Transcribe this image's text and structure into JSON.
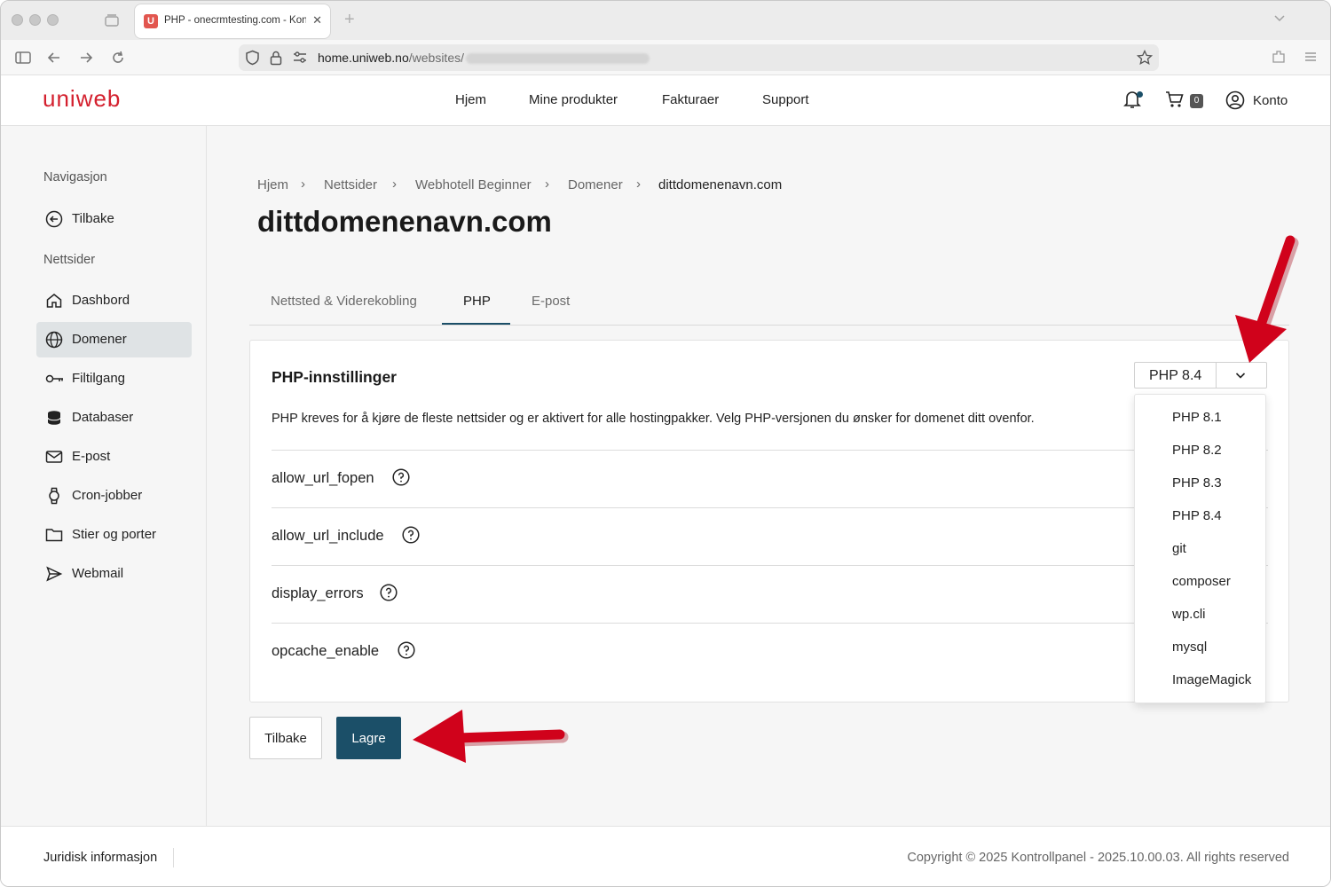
{
  "browser": {
    "tab_title": "PHP - onecrmtesting.com - Kontrollpanel",
    "tab_favicon_letter": "U",
    "url_domain": "home.uniweb.no",
    "url_path": "/websites/"
  },
  "header": {
    "logo": "uniweb",
    "nav": [
      "Hjem",
      "Mine produkter",
      "Fakturaer",
      "Support"
    ],
    "cart_count": "0",
    "account_label": "Konto"
  },
  "sidebar": {
    "heading_nav": "Navigasjon",
    "back_label": "Tilbake",
    "heading_sites": "Nettsider",
    "items": [
      {
        "label": "Dashbord",
        "icon": "home-icon"
      },
      {
        "label": "Domener",
        "icon": "globe-icon"
      },
      {
        "label": "Filtilgang",
        "icon": "key-icon"
      },
      {
        "label": "Databaser",
        "icon": "database-icon"
      },
      {
        "label": "E-post",
        "icon": "mail-icon"
      },
      {
        "label": "Cron-jobber",
        "icon": "watch-icon"
      },
      {
        "label": "Stier og porter",
        "icon": "folder-icon"
      },
      {
        "label": "Webmail",
        "icon": "send-icon"
      }
    ],
    "active_item": "Domener"
  },
  "breadcrumb": [
    "Hjem",
    "Nettsider",
    "Webhotell Beginner",
    "Domener",
    "dittdomenenavn.com"
  ],
  "page_title": "dittdomenenavn.com",
  "tabs": [
    "Nettsted & Viderekobling",
    "PHP",
    "E-post"
  ],
  "active_tab": "PHP",
  "php_card": {
    "title": "PHP-innstillinger",
    "description": "PHP kreves for å kjøre de fleste nettsider og er aktivert for alle hostingpakker. Velg PHP-versjonen du ønsker for domenet ditt ovenfor.",
    "selected_version": "PHP 8.4",
    "options": [
      "allow_url_fopen",
      "allow_url_include",
      "display_errors",
      "opcache_enable"
    ]
  },
  "dropdown_options": [
    "PHP 8.1",
    "PHP 8.2",
    "PHP 8.3",
    "PHP 8.4",
    "git",
    "composer",
    "wp.cli",
    "mysql",
    "ImageMagick"
  ],
  "buttons": {
    "back": "Tilbake",
    "save": "Lagre"
  },
  "footer": {
    "legal": "Juridisk informasjon",
    "copyright": "Copyright © 2025 Kontrollpanel - 2025.10.00.03. All rights reserved"
  },
  "colors": {
    "brand": "#d4202e",
    "primary": "#1b4f68",
    "annotation_arrow": "#d0021b"
  }
}
